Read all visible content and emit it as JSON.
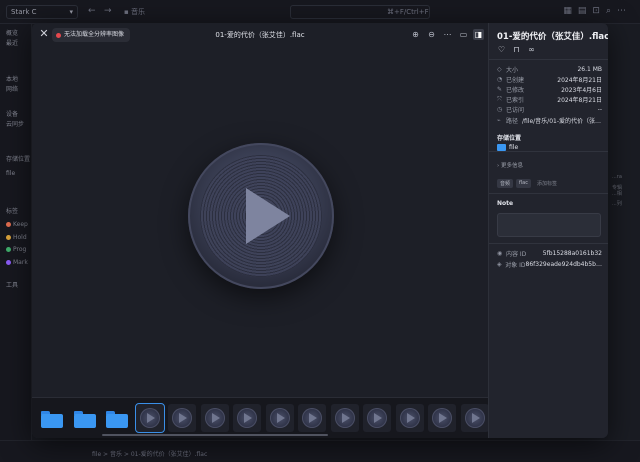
{
  "background": {
    "location": "Stark C",
    "crumb": "音乐",
    "search_hint": "⌘+F/Ctrl+F",
    "sidebar": [
      {
        "label": "概览"
      },
      {
        "label": "最近"
      },
      {
        "label": "本地"
      },
      {
        "label": "网络"
      },
      {
        "label": "设备"
      },
      {
        "label": "云同步"
      },
      {
        "label": "存储位置"
      },
      {
        "label": "file"
      },
      {
        "label": "标签"
      },
      {
        "label": "Keep",
        "color": "#e06c4f"
      },
      {
        "label": "Hold",
        "color": "#d9a33b"
      },
      {
        "label": "Prog",
        "color": "#3fae6b"
      },
      {
        "label": "Mark",
        "color": "#8b5cf6"
      },
      {
        "label": "工具"
      }
    ],
    "right_strip": [
      "...ra",
      "专辑",
      "...相",
      "...列"
    ],
    "status_path": "file  >  音乐  >  01-爱的代价（张艾佳）.flac"
  },
  "viewer": {
    "close_icon": "close-icon",
    "warning": "无法加载全分辨率图像",
    "warning_color": "#e5484d",
    "title": "01-爱的代价（张艾佳）.flac",
    "toolbar": [
      {
        "name": "zoom-in-icon",
        "glyph": "⊕"
      },
      {
        "name": "zoom-out-icon",
        "glyph": "⊖"
      },
      {
        "name": "more-icon",
        "glyph": "⋯"
      },
      {
        "name": "compact-view-icon",
        "glyph": "▭"
      },
      {
        "name": "sidebar-toggle-icon",
        "glyph": "◨"
      }
    ]
  },
  "thumbnails": [
    {
      "type": "folder"
    },
    {
      "type": "folder"
    },
    {
      "type": "folder"
    },
    {
      "type": "audio",
      "selected": true
    },
    {
      "type": "audio"
    },
    {
      "type": "audio"
    },
    {
      "type": "audio"
    },
    {
      "type": "audio"
    },
    {
      "type": "audio"
    },
    {
      "type": "audio"
    },
    {
      "type": "audio"
    },
    {
      "type": "audio"
    },
    {
      "type": "audio"
    },
    {
      "type": "audio"
    }
  ],
  "inspector": {
    "title": "01-爱的代价（张艾佳）.flac",
    "meta": [
      {
        "icon": "size-icon",
        "glyph": "◇",
        "label": "大小",
        "value": "26.1 MB"
      },
      {
        "icon": "created-icon",
        "glyph": "◔",
        "label": "已创建",
        "value": "2024年8月21日"
      },
      {
        "icon": "modified-icon",
        "glyph": "✎",
        "label": "已修改",
        "value": "2023年4月6日"
      },
      {
        "icon": "indexed-icon",
        "glyph": "⤧",
        "label": "已索引",
        "value": "2024年8月21日"
      },
      {
        "icon": "accessed-icon",
        "glyph": "◷",
        "label": "已访问",
        "value": "--"
      },
      {
        "icon": "path-icon",
        "glyph": "⌁",
        "label": "路径",
        "value": "/file/音乐/01-爱的代价（张艾..."
      }
    ],
    "locations_heading": "存储位置",
    "location": "file",
    "more_info": "更多信息",
    "tags": [
      "音频",
      "flac",
      "添加标签"
    ],
    "note_heading": "Note",
    "ids": [
      {
        "icon": "content-id-icon",
        "glyph": "◉",
        "label": "内容 ID",
        "value": "5fb15288a0161b32"
      },
      {
        "icon": "object-id-icon",
        "glyph": "◈",
        "label": "对象 ID",
        "value": "86f329eade924db4b5ba1..."
      }
    ]
  }
}
